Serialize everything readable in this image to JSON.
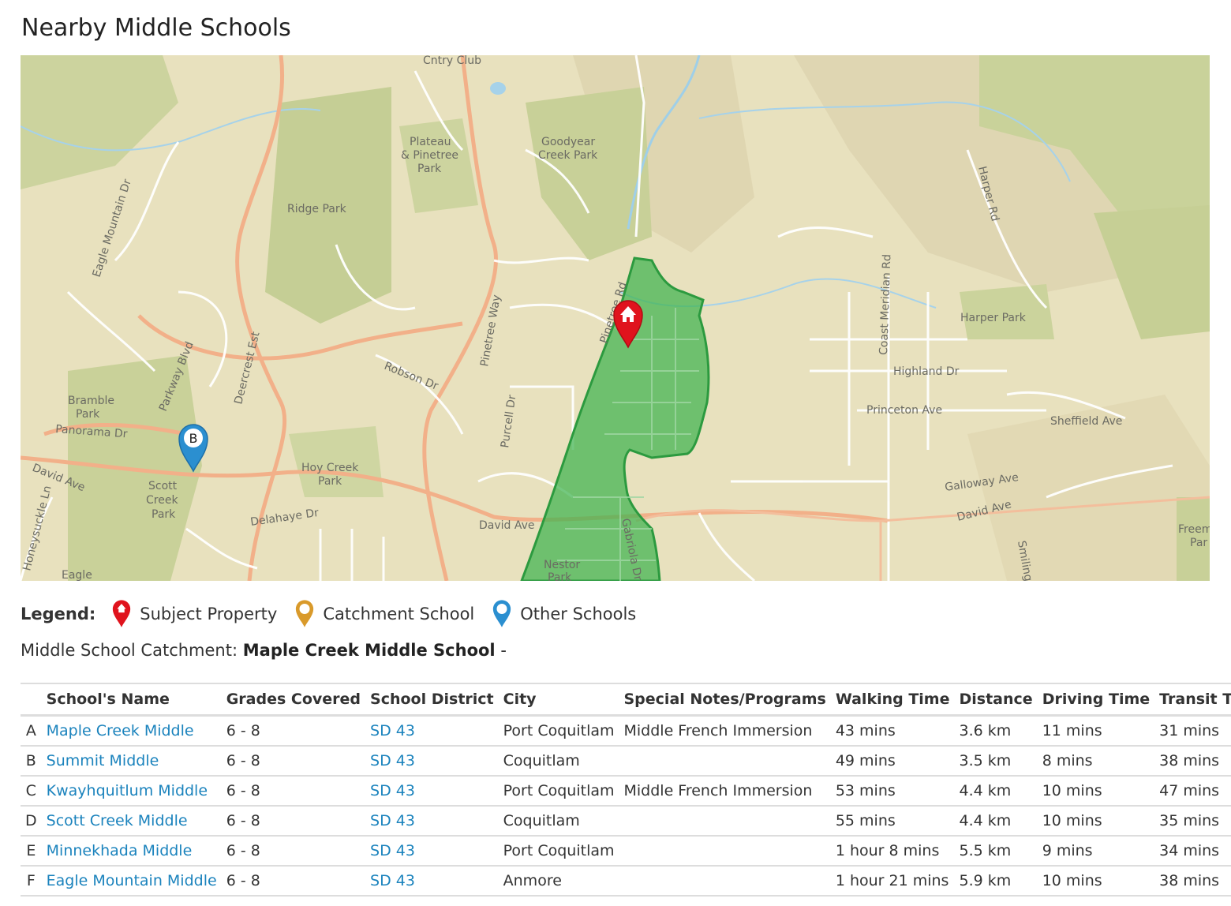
{
  "page_title": "Nearby Middle Schools",
  "map": {
    "labels": {
      "cntry_club": "Cntry Club",
      "plateau_1": "Plateau",
      "plateau_2": "& Pinetree",
      "plateau_3": "Park",
      "goodyear_1": "Goodyear",
      "goodyear_2": "Creek Park",
      "ridge_park": "Ridge Park",
      "eagle_mtn_dr": "Eagle Mountain Dr",
      "harper_rd": "Harper Rd",
      "coast_meridian": "Coast Meridian Rd",
      "harper_park": "Harper Park",
      "pinetree_rd": "Pinetree Rd",
      "pinetree_way": "Pinetree Way",
      "deercrest": "Deercrest Est",
      "parkway": "Parkway Blvd",
      "robson": "Robson Dr",
      "highland": "Highland Dr",
      "princeton": "Princeton Ave",
      "sheffield": "Sheffield Ave",
      "bramble_1": "Bramble",
      "bramble_2": "Park",
      "panorama": "Panorama Dr",
      "purcell": "Purcell Dr",
      "david_ave": "David Ave",
      "hoy_1": "Hoy Creek",
      "hoy_2": "Park",
      "scott_1": "Scott",
      "scott_2": "Creek",
      "scott_3": "Park",
      "delahaye": "Delahaye Dr",
      "galloway": "Galloway Ave",
      "gabriola": "Gabriola Dr",
      "nestor_1": "Nestor",
      "nestor_2": "Park",
      "honeysuckle": "Honeysuckle Ln",
      "eagle": "Eagle",
      "smiling": "Smiling",
      "freem_1": "Freem",
      "freem_2": "Par"
    },
    "markers": [
      {
        "letter": "B",
        "type": "other-school",
        "color": "#2b8fd0"
      },
      {
        "type": "subject-property",
        "icon": "house-icon",
        "color": "#e0131d"
      }
    ],
    "catchment_color": "#3fb34f"
  },
  "legend": {
    "title": "Legend:",
    "items": [
      {
        "label": "Subject Property",
        "color": "#e0131d",
        "icon": "red-house-pin-icon"
      },
      {
        "label": "Catchment School",
        "color": "#d99a2b",
        "icon": "orange-pin-icon"
      },
      {
        "label": "Other Schools",
        "color": "#2b8fd0",
        "icon": "blue-pin-icon"
      }
    ]
  },
  "catchment": {
    "label": "Middle School Catchment:",
    "school": "Maple Creek Middle School",
    "suffix": "-"
  },
  "table": {
    "headers": [
      "",
      "School's Name",
      "Grades Covered",
      "School District",
      "City",
      "Special Notes/Programs",
      "Walking Time",
      "Distance",
      "Driving Time",
      "Transit Time"
    ],
    "rows": [
      {
        "letter": "A",
        "name": "Maple Creek Middle",
        "grades": "6 - 8",
        "district": "SD 43",
        "city": "Port Coquitlam",
        "notes": "Middle French Immersion",
        "walking": "43 mins",
        "distance": "3.6 km",
        "driving": "11 mins",
        "transit": "31 mins"
      },
      {
        "letter": "B",
        "name": "Summit Middle",
        "grades": "6 - 8",
        "district": "SD 43",
        "city": "Coquitlam",
        "notes": "",
        "walking": "49 mins",
        "distance": "3.5 km",
        "driving": "8 mins",
        "transit": "38 mins"
      },
      {
        "letter": "C",
        "name": "Kwayhquitlum Middle",
        "grades": "6 - 8",
        "district": "SD 43",
        "city": "Port Coquitlam",
        "notes": "Middle French Immersion",
        "walking": "53 mins",
        "distance": "4.4 km",
        "driving": "10 mins",
        "transit": "47 mins"
      },
      {
        "letter": "D",
        "name": "Scott Creek Middle",
        "grades": "6 - 8",
        "district": "SD 43",
        "city": "Coquitlam",
        "notes": "",
        "walking": "55 mins",
        "distance": "4.4 km",
        "driving": "10 mins",
        "transit": "35 mins"
      },
      {
        "letter": "E",
        "name": "Minnekhada Middle",
        "grades": "6 - 8",
        "district": "SD 43",
        "city": "Port Coquitlam",
        "notes": "",
        "walking": "1 hour 8 mins",
        "distance": "5.5 km",
        "driving": "9 mins",
        "transit": "34 mins"
      },
      {
        "letter": "F",
        "name": "Eagle Mountain Middle",
        "grades": "6 - 8",
        "district": "SD 43",
        "city": "Anmore",
        "notes": "",
        "walking": "1 hour 21 mins",
        "distance": "5.9 km",
        "driving": "10 mins",
        "transit": "38 mins"
      }
    ]
  }
}
